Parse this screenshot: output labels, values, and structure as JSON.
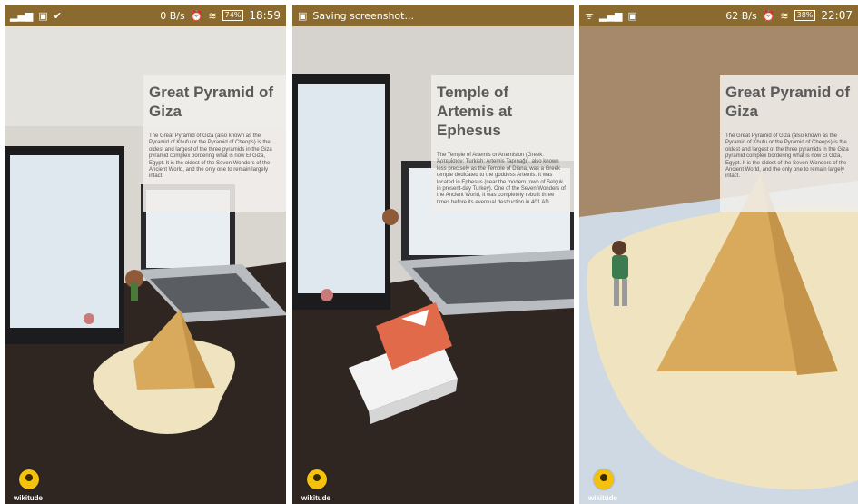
{
  "panels": [
    {
      "status": {
        "left_icons": "signal, image, check",
        "speed": "0 B/s",
        "battery": "74%",
        "time": "18:59"
      },
      "card": {
        "title": "Great Pyramid of Giza",
        "description": "The Great Pyramid of Giza (also known as the Pyramid of Khufu or the Pyramid of Cheops) is the oldest and largest of the three pyramids in the Giza pyramid complex bordering what is now El Giza, Egypt. It is the oldest of the Seven Wonders of the Ancient World, and the only one to remain largely intact."
      },
      "brand": "wikitude"
    },
    {
      "status": {
        "notification": "Saving screenshot..."
      },
      "card": {
        "title": "Temple of Artemis at Ephesus",
        "description": "The Temple of Artemis or Artemision (Greek: Ἀρτεμίσιον; Turkish: Artemis Tapınağı), also known less precisely as the Temple of Diana, was a Greek temple dedicated to the goddess Artemis. It was located in Ephesus (near the modern town of Selçuk in present-day Turkey). One of the Seven Wonders of the Ancient World, it was completely rebuilt three times before its eventual destruction in 401 AD."
      },
      "brand": "wikitude"
    },
    {
      "status": {
        "left_icons": "wifi, signal, image",
        "speed": "62 B/s",
        "battery": "38%",
        "time": "22:07"
      },
      "card": {
        "title": "Great Pyramid of Giza",
        "description": "The Great Pyramid of Giza (also known as the Pyramid of Khufu or the Pyramid of Cheops) is the oldest and largest of the three pyramids in the Giza pyramid complex bordering what is now El Giza, Egypt. It is the oldest of the Seven Wonders of the Ancient World, and the only one to remain largely intact."
      },
      "brand": "wikitude"
    }
  ],
  "colors": {
    "status_bar": "#8a6a2e",
    "pyramid": "#d9aa5c",
    "base_plate": "#efe4bf",
    "temple_roof": "#e06a4a",
    "logo": "#f4c20d"
  }
}
